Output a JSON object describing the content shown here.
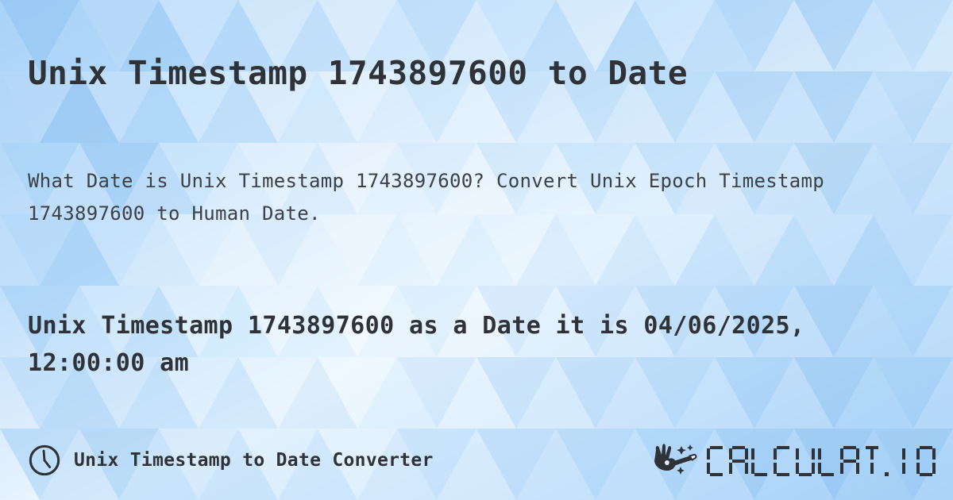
{
  "meta": {
    "timestamp": "1743897600",
    "converted_date": "04/06/2025, 12:00:00 am",
    "accent_color": "#2f3337",
    "background_base": "#bcdcfa",
    "background_light": "#f4fbff"
  },
  "page": {
    "title": "Unix Timestamp 1743897600 to Date",
    "description": "What Date is Unix Timestamp 1743897600? Convert Unix Epoch Timestamp 1743897600 to Human Date.",
    "result": "Unix Timestamp 1743897600 as a Date it is 04/06/2025, 12:00:00 am"
  },
  "footer": {
    "clock_icon": "clock-icon",
    "label": "Unix Timestamp to Date Converter",
    "brand": {
      "wand_icon": "magic-wand-hand-icon",
      "name": "CALCULAT.IO",
      "letters": [
        "C",
        "A",
        "L",
        "C",
        "U",
        "L",
        "A",
        "T",
        ".",
        "I",
        "O"
      ]
    }
  }
}
